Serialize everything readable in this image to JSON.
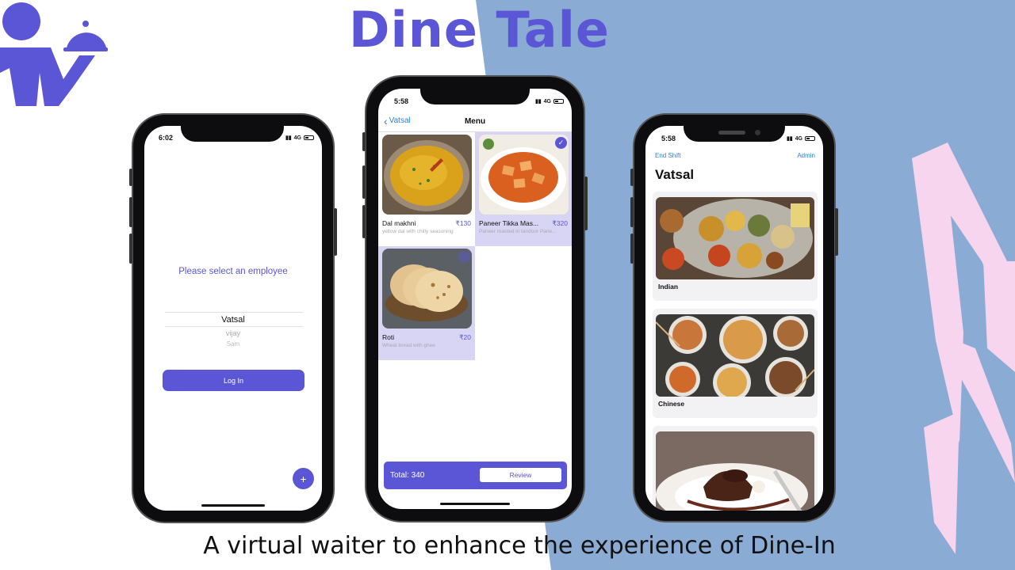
{
  "title": {
    "part1": "Dine",
    "part2": "Tale"
  },
  "tagline": "A virtual waiter to enhance the experience of Dine-In",
  "colors": {
    "accent": "#5b56d6",
    "panel_blue": "#8aabd3",
    "brush_pink": "#f7d5ee",
    "link_blue": "#2f7fe0"
  },
  "logo": {
    "icon": "waiter-with-cloche-icon"
  },
  "login_screen": {
    "time": "6:02",
    "network": "4G",
    "prompt": "Please select an employee",
    "picker": [
      "Vatsal",
      "vijay",
      "Sam"
    ],
    "login_label": "Log In",
    "fab_label": "+"
  },
  "menu_screen": {
    "time": "5:58",
    "network": "4G",
    "back_label": "Vatsal",
    "title": "Menu",
    "items": [
      {
        "name": "Dal makhni",
        "price": "₹130",
        "desc": "yellow dal with chilly seasoning",
        "selected": false
      },
      {
        "name": "Paneer Tikka Mas...",
        "price": "₹320",
        "desc": "Paneer roasted in tandoor Pane...",
        "selected": true
      },
      {
        "name": "Roti",
        "price": "₹20",
        "desc": "Wheat bread with ghee",
        "selected": true
      }
    ],
    "total_label": "Total: 340",
    "review_label": "Review"
  },
  "category_screen": {
    "time": "5:58",
    "network": "4G",
    "end_shift_label": "End Shift",
    "admin_label": "Admin",
    "waiter_name": "Vatsal",
    "categories": [
      {
        "label": "Indian"
      },
      {
        "label": "Chinese"
      },
      {
        "label": ""
      }
    ]
  }
}
